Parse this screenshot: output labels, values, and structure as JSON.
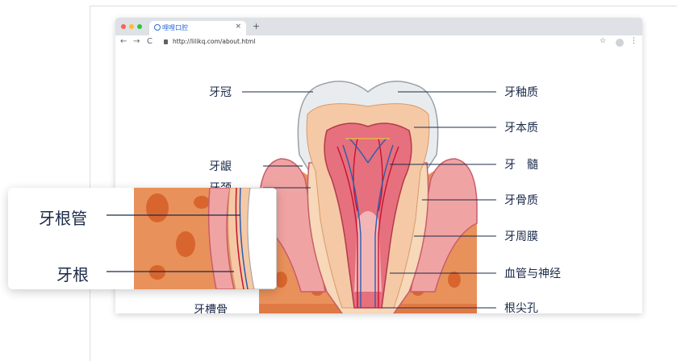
{
  "browser": {
    "tab_title": "哩哩口腔",
    "tab_close": "×",
    "new_tab": "+",
    "url": "http://lilikq.com/about.html",
    "nav_back": "←",
    "nav_forward": "→",
    "nav_reload": "C",
    "bookmark": "☆",
    "menu": "⋮"
  },
  "diagram": {
    "left_labels": [
      "牙冠",
      "牙龈",
      "牙颈"
    ],
    "right_labels": [
      "牙釉质",
      "牙本质",
      "牙　髓",
      "牙骨质",
      "牙周膜",
      "血管与神经",
      "根尖孔"
    ],
    "partial_label": "牙槽骨"
  },
  "zoom_popout": {
    "labels": [
      "牙根管",
      "牙根"
    ]
  },
  "colors": {
    "label_text": "#1b2a4a",
    "leader_line": "#1b2a4a",
    "enamel": "#e9ecef",
    "dentin": "#f5c9a6",
    "pulp": "#e6707e",
    "gum": "#f0a3a3",
    "bone": "#e9915a",
    "vessel_red": "#c8102e",
    "vessel_blue": "#2a5db0"
  }
}
